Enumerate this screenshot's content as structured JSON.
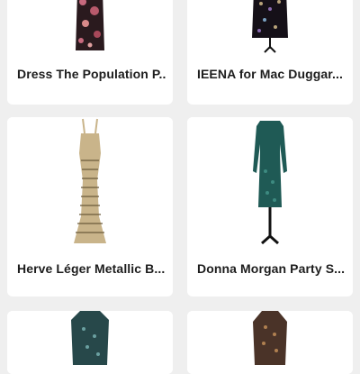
{
  "products": [
    {
      "title": "Dress The Population P...",
      "image": "dress-floral-black-pink"
    },
    {
      "title": "IEENA for Mac Duggar...",
      "image": "dress-embellished-black"
    },
    {
      "title": "Herve Léger Metallic B...",
      "image": "gown-gold-metallic"
    },
    {
      "title": "Donna Morgan Party S...",
      "image": "dress-green-sequin"
    },
    {
      "title": "",
      "image": "dress-teal-sequin"
    },
    {
      "title": "",
      "image": "dress-bronze-sequin"
    }
  ],
  "colors": {
    "background": "#efefef",
    "card": "#ffffff",
    "text": "#1d1d1d"
  }
}
